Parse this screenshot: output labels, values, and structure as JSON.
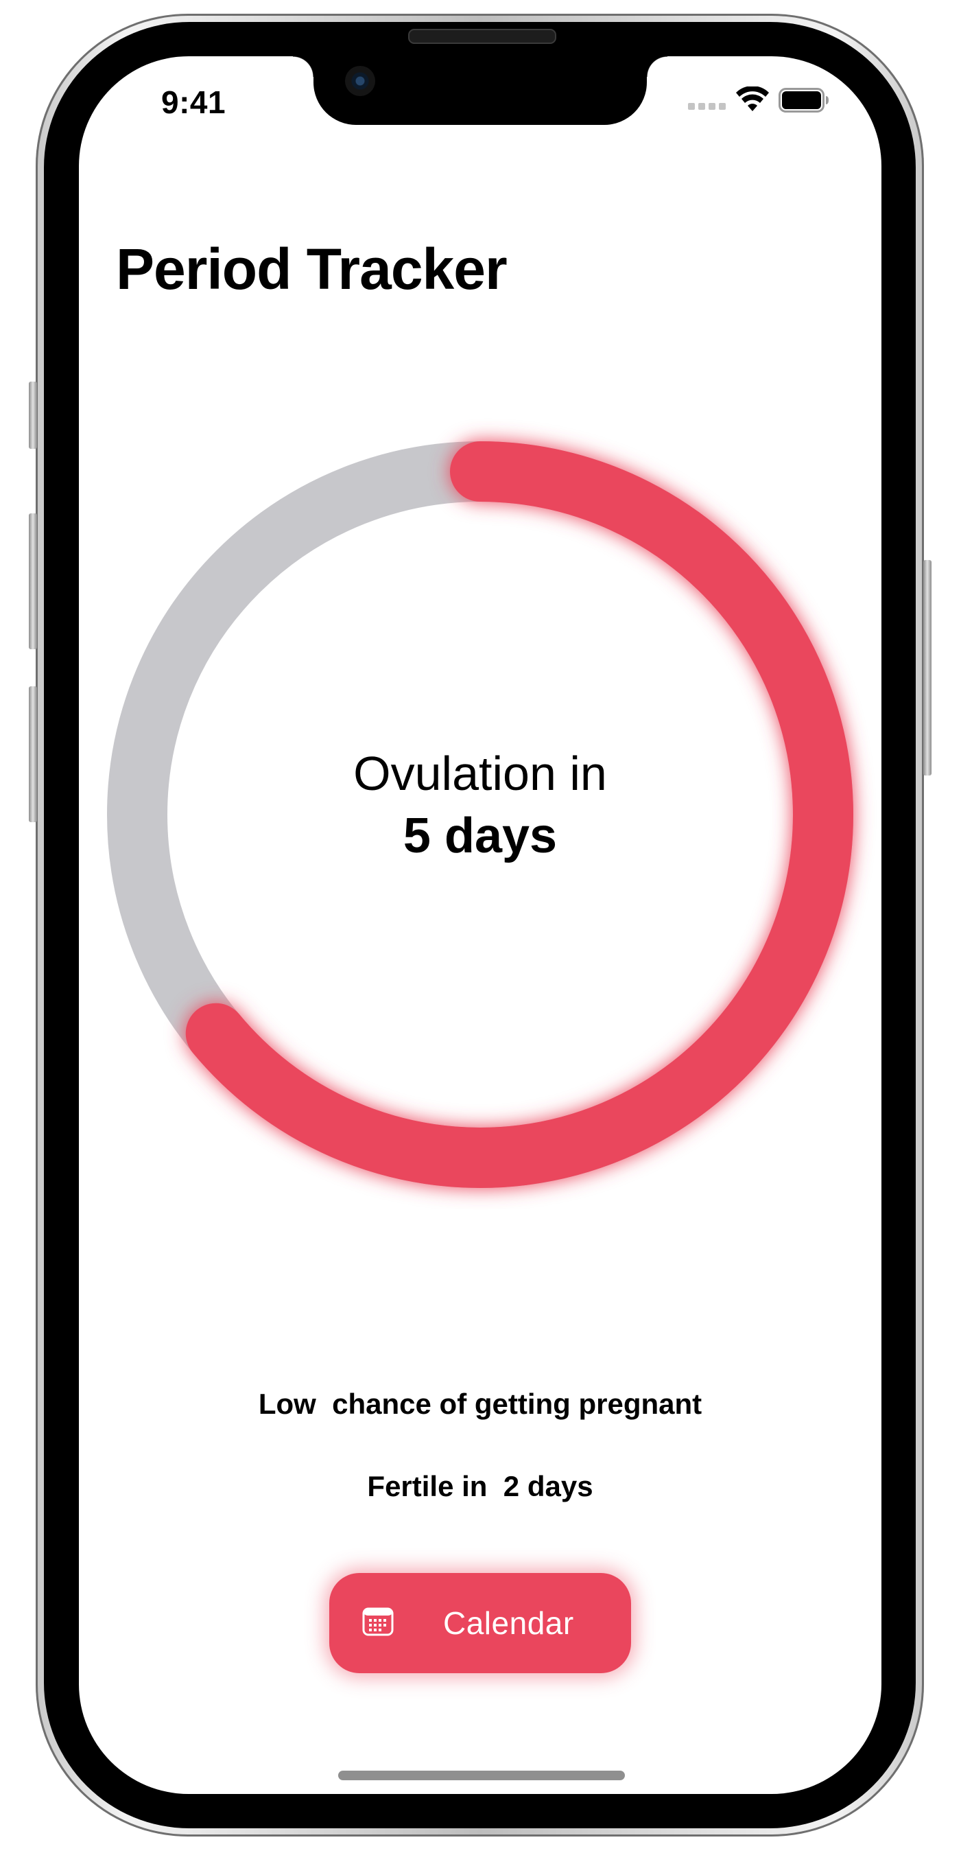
{
  "status_bar": {
    "time": "9:41",
    "icons": [
      "cellular-signal-icon",
      "wifi-icon",
      "battery-icon"
    ]
  },
  "header": {
    "title": "Period Tracker"
  },
  "cycle_ring": {
    "label": "Ovulation in",
    "value": "5 days",
    "progress_fraction": 0.64,
    "colors": {
      "progress": "#ea465d",
      "track": "#c7c7cb"
    }
  },
  "info": {
    "pregnancy_chance": "Low  chance of getting pregnant",
    "fertile": "Fertile in  2 days"
  },
  "calendar_button": {
    "label": "Calendar",
    "icon": "calendar-icon",
    "color": "#ea465d"
  }
}
